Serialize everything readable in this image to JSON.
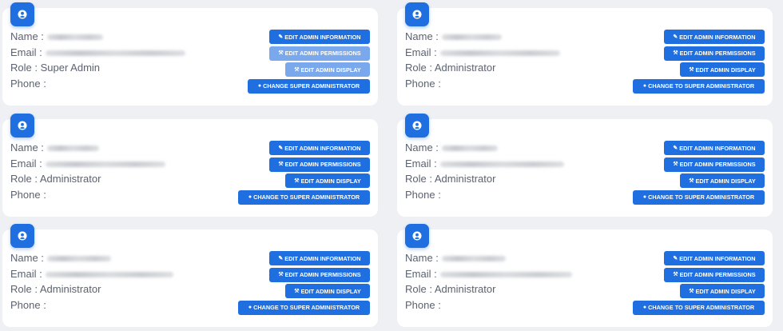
{
  "labels": {
    "name": "Name :",
    "email": "Email :",
    "role": "Role : ",
    "phone": "Phone :"
  },
  "buttons": {
    "edit_info": "EDIT ADMIN INFORMATION",
    "edit_permissions": "EDIT ADMIN PERMISSIONS",
    "edit_display": "EDIT ADMIN DISPLAY",
    "change_super": "CHANGE SUPER ADMINISTRATOR",
    "change_to_super": "CHANGE TO SUPER ADMINISTRATOR"
  },
  "icons": {
    "avatar": "user-circle-icon",
    "edit_info": "pencil-icon",
    "edit_permissions": "wrench-icon",
    "edit_display": "wrench-icon",
    "change": "user-icon"
  },
  "colors": {
    "primary": "#1f6fe0",
    "primary_disabled": "#7aa8ec",
    "background": "#eef0f4",
    "card": "#ffffff",
    "text": "#5b6270"
  },
  "admins": [
    {
      "role": "Super Admin",
      "name": "",
      "email": "",
      "phone": "",
      "change_label_key": "change_super",
      "permissions_disabled": true,
      "display_disabled": true
    },
    {
      "role": "Administrator",
      "name": "",
      "email": "",
      "phone": "",
      "change_label_key": "change_to_super",
      "permissions_disabled": false,
      "display_disabled": false
    },
    {
      "role": "Administrator",
      "name": "",
      "email": "",
      "phone": "",
      "change_label_key": "change_to_super",
      "permissions_disabled": false,
      "display_disabled": false
    },
    {
      "role": "Administrator",
      "name": "",
      "email": "",
      "phone": "",
      "change_label_key": "change_to_super",
      "permissions_disabled": false,
      "display_disabled": false
    },
    {
      "role": "Administrator",
      "name": "",
      "email": "",
      "phone": "",
      "change_label_key": "change_to_super",
      "permissions_disabled": false,
      "display_disabled": false
    },
    {
      "role": "Administrator",
      "name": "",
      "email": "",
      "phone": "",
      "change_label_key": "change_to_super",
      "permissions_disabled": false,
      "display_disabled": false
    }
  ]
}
